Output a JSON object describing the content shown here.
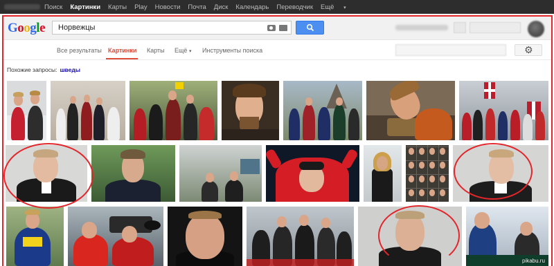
{
  "topbar": {
    "links": [
      "Поиск",
      "Картинки",
      "Карты",
      "Play",
      "Новости",
      "Почта",
      "Диск",
      "Календарь",
      "Переводчик",
      "Ещё"
    ],
    "active_index": 1
  },
  "logo": {
    "letters": [
      "G",
      "o",
      "o",
      "g",
      "l",
      "e"
    ],
    "colors": [
      "#3369e8",
      "#d50f25",
      "#eeb211",
      "#3369e8",
      "#009925",
      "#d50f25"
    ]
  },
  "search": {
    "query": "Норвежцы"
  },
  "tabs": {
    "items": [
      "Все результаты",
      "Картинки",
      "Карты",
      "Ещё",
      "Инструменты поиска"
    ],
    "active_index": 1
  },
  "related": {
    "label": "Похожие запросы:",
    "link": "шведы"
  },
  "watermark": "pikabu.ru",
  "colors": {
    "accent_red": "#dd4b39",
    "search_blue": "#4d8ff0",
    "annotation_red": "#e3262b"
  }
}
